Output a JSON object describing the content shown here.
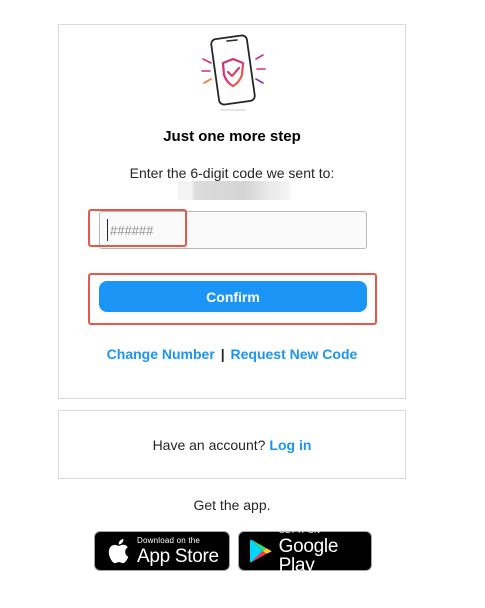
{
  "verify": {
    "title": "Just one more step",
    "subtitle": "Enter the 6-digit code we sent to:",
    "code_placeholder": "######",
    "confirm_label": "Confirm",
    "change_number_label": "Change Number",
    "separator": "|",
    "request_code_label": "Request New Code"
  },
  "account": {
    "prompt": "Have an account?",
    "login_label": "Log in"
  },
  "app": {
    "get_app_label": "Get the app.",
    "app_store_small": "Download on the",
    "app_store_large": "App Store",
    "google_play_small": "GET IT ON",
    "google_play_large": "Google Play"
  },
  "colors": {
    "link": "#1b95f5",
    "button": "#1b95f5",
    "highlight": "#e8584a"
  },
  "icons": {
    "illustration": "phone-shield-icon",
    "apple": "apple-icon",
    "google_play": "google-play-icon"
  }
}
